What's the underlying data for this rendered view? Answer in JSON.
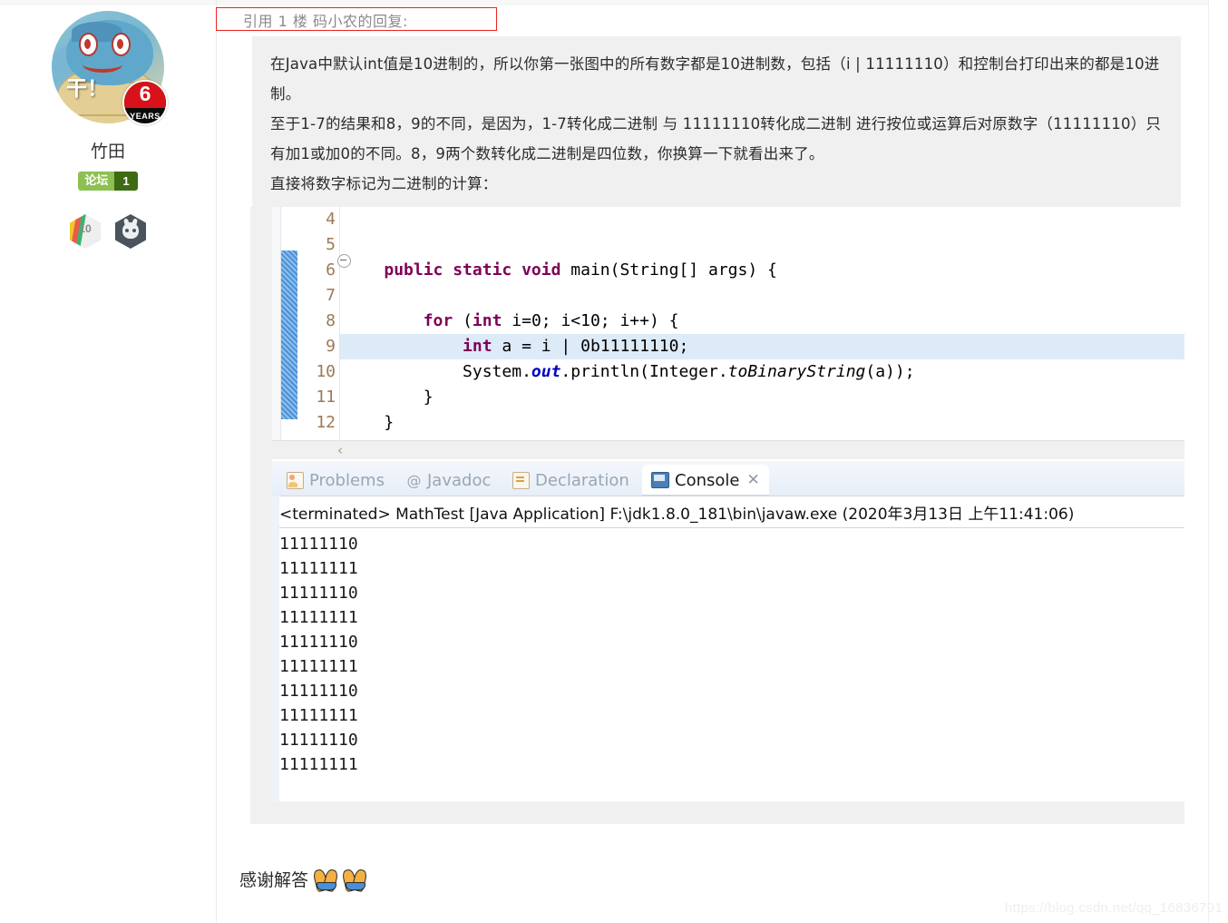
{
  "quote": {
    "header_label": "引用 1 楼 码小农的回复:",
    "paragraphs": [
      "在Java中默认int值是10进制的，所以你第一张图中的所有数字都是10进制数，包括（i | 11111110）和控制台打印出来的都是10进制。",
      "至于1-7的结果和8，9的不同，是因为，1-7转化成二进制 与 11111110转化成二进制 进行按位或运算后对原数字（11111110）只有加1或加0的不同。8，9两个数转化成二进制是四位数，你换算一下就看出来了。",
      "直接将数字标记为二进制的计算："
    ]
  },
  "author": {
    "name": "竹田",
    "avatar_overlay_text": "干！",
    "years_badge_number": "6",
    "years_badge_label": "YEARS",
    "forum_badge_name": "论坛",
    "forum_badge_level": "1",
    "medals": [
      {
        "name": "blog-medal",
        "number": "10"
      },
      {
        "name": "github-medal",
        "number": ""
      }
    ]
  },
  "editor": {
    "line_numbers": [
      "4",
      "5",
      "6",
      "7",
      "8",
      "9",
      "10",
      "11",
      "12"
    ],
    "lines": [
      {
        "num": "4",
        "tokens": [],
        "highlight": false
      },
      {
        "num": "5",
        "tokens": [],
        "highlight": false
      },
      {
        "num": "6",
        "tokens": [
          {
            "t": "    ",
            "c": "plain"
          },
          {
            "t": "public static void ",
            "c": "kw"
          },
          {
            "t": "main(String[] args) {",
            "c": "plain"
          }
        ],
        "highlight": false
      },
      {
        "num": "7",
        "tokens": [],
        "highlight": false
      },
      {
        "num": "8",
        "tokens": [
          {
            "t": "        ",
            "c": "plain"
          },
          {
            "t": "for ",
            "c": "kw"
          },
          {
            "t": "(",
            "c": "plain"
          },
          {
            "t": "int ",
            "c": "kw"
          },
          {
            "t": "i=0; i<10; i++) {",
            "c": "plain"
          }
        ],
        "highlight": false
      },
      {
        "num": "9",
        "tokens": [
          {
            "t": "            ",
            "c": "plain"
          },
          {
            "t": "int ",
            "c": "kw"
          },
          {
            "t": "a = i | 0b11111110;",
            "c": "plain"
          }
        ],
        "highlight": true
      },
      {
        "num": "10",
        "tokens": [
          {
            "t": "            System.",
            "c": "plain"
          },
          {
            "t": "out",
            "c": "fld"
          },
          {
            "t": ".println(Integer.",
            "c": "plain"
          },
          {
            "t": "toBinaryString",
            "c": "ital"
          },
          {
            "t": "(a));",
            "c": "plain"
          }
        ],
        "highlight": false
      },
      {
        "num": "11",
        "tokens": [
          {
            "t": "        }",
            "c": "plain"
          }
        ],
        "highlight": false
      },
      {
        "num": "12",
        "tokens": [
          {
            "t": "    }",
            "c": "plain"
          }
        ],
        "highlight": false
      }
    ],
    "hscroll_chevron": "‹"
  },
  "console": {
    "tabs": [
      {
        "label": "Problems",
        "icon": "problems-icon",
        "active": false
      },
      {
        "label": "Javadoc",
        "icon": "at-icon",
        "active": false
      },
      {
        "label": "Declaration",
        "icon": "declaration-icon",
        "active": false
      },
      {
        "label": "Console",
        "icon": "console-icon",
        "active": true
      }
    ],
    "close_glyph": "✕",
    "terminated_line": "<terminated> MathTest [Java Application] F:\\jdk1.8.0_181\\bin\\javaw.exe (2020年3月13日 上午11:41:06)",
    "output_lines": [
      "11111110",
      "11111111",
      "11111110",
      "11111111",
      "11111110",
      "11111111",
      "11111110",
      "11111111",
      "11111110",
      "11111111"
    ]
  },
  "footer": {
    "thanks_text": "感谢解答",
    "watermark": "https://blog.csdn.net/qq_16836791"
  },
  "colors": {
    "keyword": "#7f0055",
    "field": "#0000c0",
    "quote_bg": "#f0f0f0",
    "highlight_row": "#ddeaf8",
    "quote_border": "#e8251f",
    "badge_green": "#8cc152",
    "badge_dark_green": "#3d6b14"
  }
}
